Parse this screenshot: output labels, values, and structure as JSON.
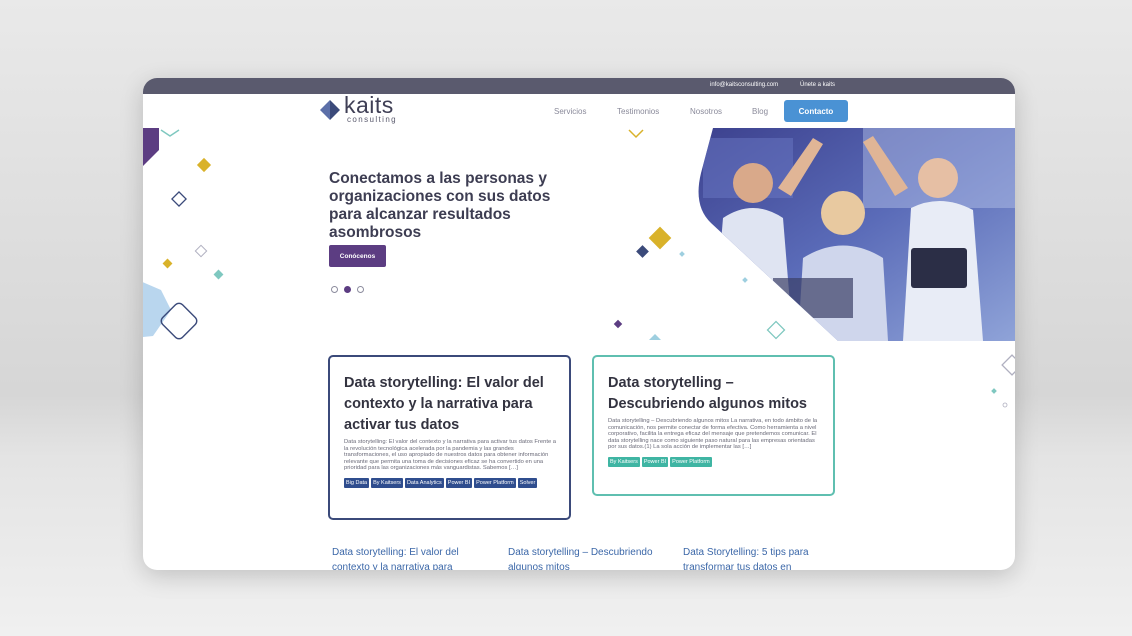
{
  "topbar": {
    "email": "info@kaitsconsulting.com",
    "join": "Únete a kaits"
  },
  "logo": {
    "name": "kaits",
    "sub": "consulting"
  },
  "nav": {
    "items": [
      "Servicios",
      "Testimonios",
      "Nosotros",
      "Blog"
    ],
    "contact": "Contacto"
  },
  "hero": {
    "title": "Conectamos a las personas y organizaciones con sus datos para alcanzar resultados asombrosos",
    "button": "Conócenos",
    "active_slide": 2,
    "slide_count": 3
  },
  "cards": [
    {
      "title": "Data storytelling: El valor del contexto y la narrativa para activar tus datos",
      "excerpt": "Data storytelling: El valor del contexto y la narrativa para activar tus datos Frente a la revolución tecnológica acelerada por la pandemia y las grandes transformaciones, el uso apropiado de nuestros datos para obtener información relevante que permita una toma de decisiones eficaz se ha convertido en una prioridad para las organizaciones más vanguardistas. Sabemos […]",
      "tags": [
        "Big Data",
        "By Kaitsers",
        "Data Analytics",
        "Power BI",
        "Power Platform",
        "Solver"
      ]
    },
    {
      "title": "Data storytelling – Descubriendo algunos mitos",
      "excerpt": "Data storytelling – Descubriendo algunos mitos La narrativa, en todo ámbito de la comunicación, nos permite conectar de forma efectiva. Como herramienta a nivel corporativo, facilita la entrega eficaz del mensaje que pretendemos comunicar. El data storytelling nace como siguiente paso natural para las empresas orientadas por sus datos.(1) La sola acción de implementar las […]",
      "tags": [
        "By Kaitsers",
        "Power BI",
        "Power Platform"
      ]
    }
  ],
  "bottom_links": [
    "Data storytelling: El valor del contexto y la narrativa para",
    "Data storytelling – Descubriendo algunos mitos",
    "Data Storytelling: 5 tips para transformar tus datos en"
  ],
  "colors": {
    "topbar": "#5a5a6e",
    "contact_button": "#4a92d4",
    "hero_button": "#5c3d82",
    "card1_border": "#3b4a7a",
    "card2_border": "#5fbfb0",
    "tag_navy": "#2f4d8e",
    "tag_teal": "#3fb5a3",
    "gold": "#d9b22a",
    "link_blue": "#3b67a8"
  }
}
